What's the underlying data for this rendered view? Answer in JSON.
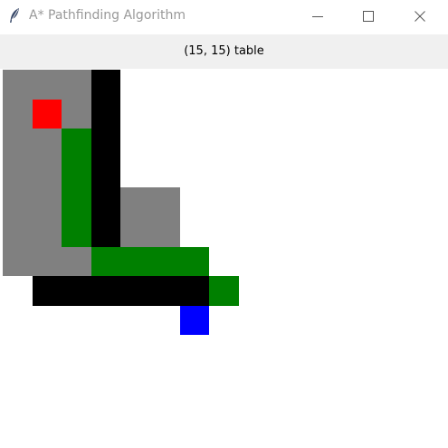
{
  "window": {
    "title": "A* Pathfinding Algorithm"
  },
  "icons": {
    "app": "feather-icon",
    "minimize": "minimize-icon",
    "maximize": "maximize-icon",
    "close": "close-icon"
  },
  "status_label": "(15, 15) table",
  "colors": {
    "visited": "#808080",
    "wall": "#000000",
    "path": "#008000",
    "start": "#ff0000",
    "end": "#0000ff",
    "empty": "#ffffff"
  },
  "grid": {
    "rows": 15,
    "cols": 15,
    "cells": [
      {
        "r": 0,
        "c": 0,
        "state": "visited"
      },
      {
        "r": 0,
        "c": 1,
        "state": "visited"
      },
      {
        "r": 0,
        "c": 2,
        "state": "visited"
      },
      {
        "r": 0,
        "c": 3,
        "state": "wall"
      },
      {
        "r": 1,
        "c": 0,
        "state": "visited"
      },
      {
        "r": 1,
        "c": 1,
        "state": "start"
      },
      {
        "r": 1,
        "c": 2,
        "state": "visited"
      },
      {
        "r": 1,
        "c": 3,
        "state": "wall"
      },
      {
        "r": 2,
        "c": 0,
        "state": "visited"
      },
      {
        "r": 2,
        "c": 1,
        "state": "visited"
      },
      {
        "r": 2,
        "c": 2,
        "state": "path"
      },
      {
        "r": 2,
        "c": 3,
        "state": "wall"
      },
      {
        "r": 3,
        "c": 0,
        "state": "visited"
      },
      {
        "r": 3,
        "c": 1,
        "state": "visited"
      },
      {
        "r": 3,
        "c": 2,
        "state": "path"
      },
      {
        "r": 3,
        "c": 3,
        "state": "wall"
      },
      {
        "r": 4,
        "c": 0,
        "state": "visited"
      },
      {
        "r": 4,
        "c": 1,
        "state": "visited"
      },
      {
        "r": 4,
        "c": 2,
        "state": "path"
      },
      {
        "r": 4,
        "c": 3,
        "state": "wall"
      },
      {
        "r": 4,
        "c": 4,
        "state": "visited"
      },
      {
        "r": 4,
        "c": 5,
        "state": "visited"
      },
      {
        "r": 5,
        "c": 0,
        "state": "visited"
      },
      {
        "r": 5,
        "c": 1,
        "state": "visited"
      },
      {
        "r": 5,
        "c": 2,
        "state": "path"
      },
      {
        "r": 5,
        "c": 3,
        "state": "wall"
      },
      {
        "r": 5,
        "c": 4,
        "state": "visited"
      },
      {
        "r": 5,
        "c": 5,
        "state": "visited"
      },
      {
        "r": 6,
        "c": 0,
        "state": "visited"
      },
      {
        "r": 6,
        "c": 1,
        "state": "visited"
      },
      {
        "r": 6,
        "c": 2,
        "state": "visited"
      },
      {
        "r": 6,
        "c": 3,
        "state": "path"
      },
      {
        "r": 6,
        "c": 4,
        "state": "path"
      },
      {
        "r": 6,
        "c": 5,
        "state": "path"
      },
      {
        "r": 6,
        "c": 6,
        "state": "path"
      },
      {
        "r": 7,
        "c": 1,
        "state": "wall"
      },
      {
        "r": 7,
        "c": 2,
        "state": "wall"
      },
      {
        "r": 7,
        "c": 3,
        "state": "wall"
      },
      {
        "r": 7,
        "c": 4,
        "state": "wall"
      },
      {
        "r": 7,
        "c": 5,
        "state": "wall"
      },
      {
        "r": 7,
        "c": 6,
        "state": "wall"
      },
      {
        "r": 7,
        "c": 7,
        "state": "path"
      },
      {
        "r": 8,
        "c": 6,
        "state": "end"
      }
    ]
  }
}
